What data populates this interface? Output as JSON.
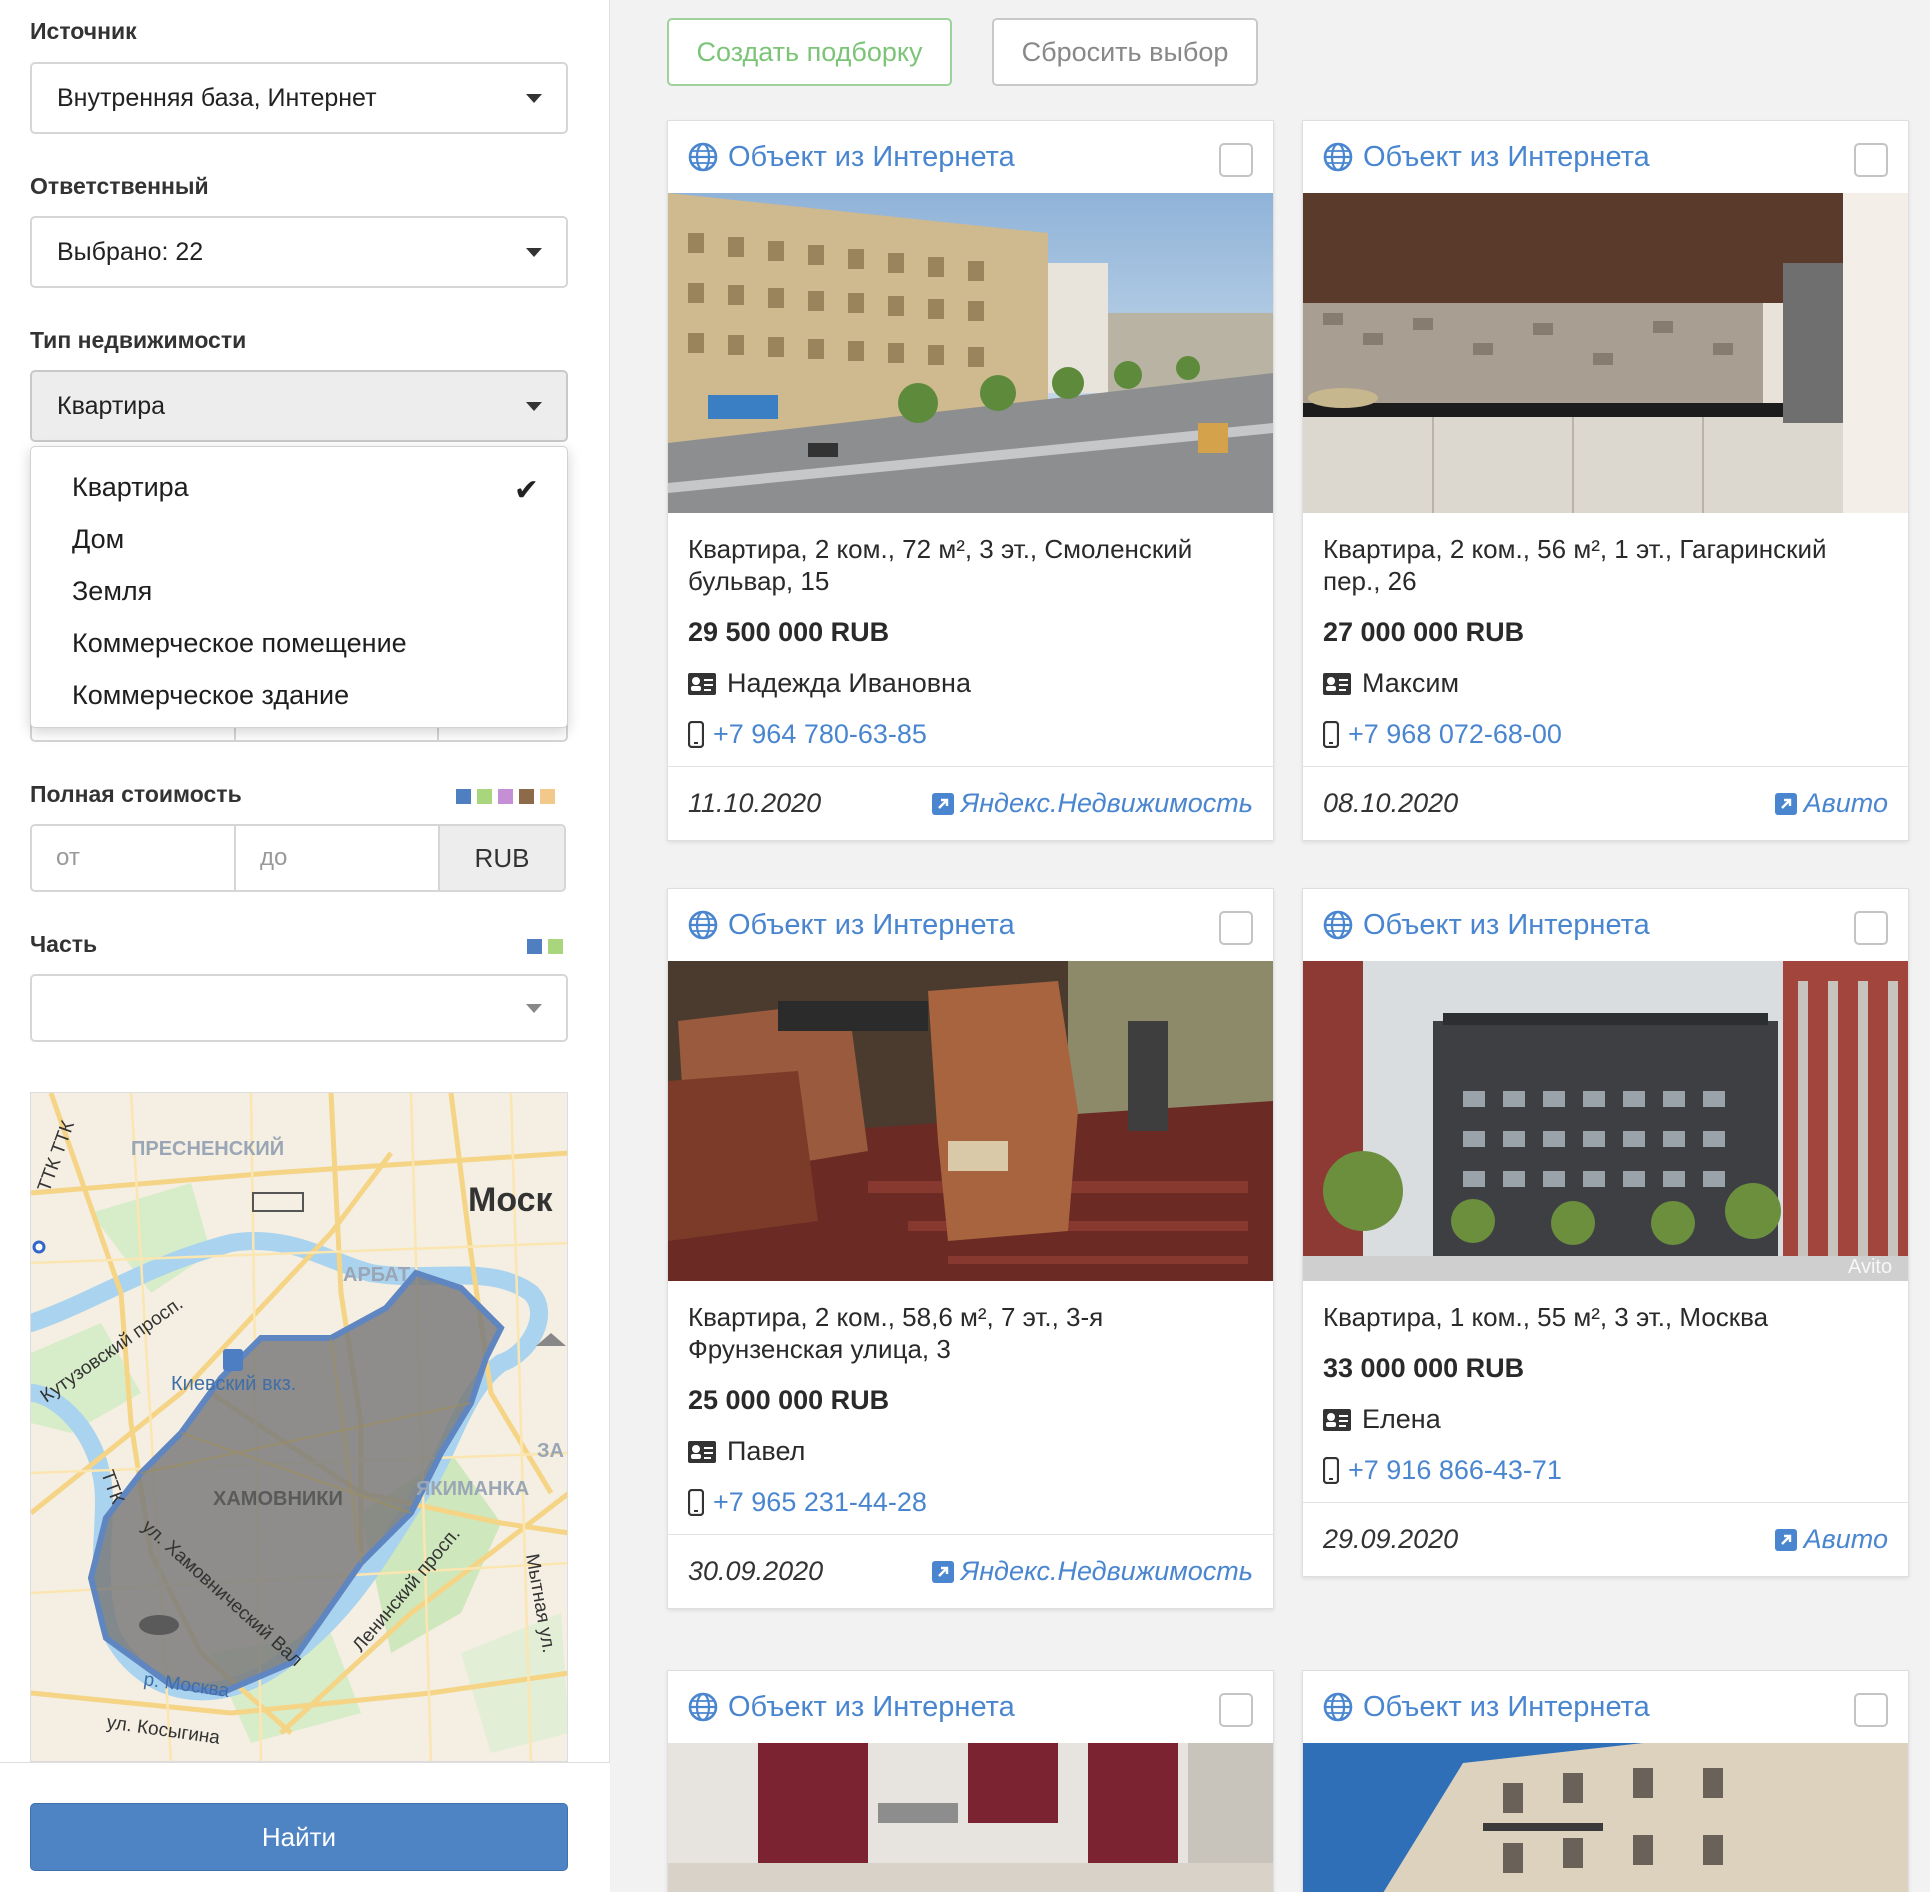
{
  "sidebar": {
    "source": {
      "label": "Источник",
      "value": "Внутренняя база, Интернет"
    },
    "responsible": {
      "label": "Ответственный",
      "value": "Выбрано: 22"
    },
    "property_type": {
      "label": "Тип недвижимости",
      "value": "Квартира",
      "options": [
        "Квартира",
        "Дом",
        "Земля",
        "Коммерческое помещение",
        "Коммерческое здание"
      ],
      "selected_index": 0
    },
    "price": {
      "label": "Полная стоимость",
      "from_placeholder": "от",
      "to_placeholder": "до",
      "currency": "RUB",
      "swatch_colors": [
        "#4f7fc0",
        "#a9d67d",
        "#c58fd6",
        "#8c6a4a",
        "#f2c98a"
      ]
    },
    "part": {
      "label": "Часть",
      "value": "",
      "swatch_colors": [
        "#4f7fc0",
        "#a9d67d"
      ]
    },
    "map": {
      "labels": {
        "presnensky": "ПРЕСНЕНСКИЙ",
        "moscow": "Моск",
        "arbat": "АРБАТ",
        "kutuzovsky": "Кутузовский просп.",
        "kievsky": "Киевский вкз.",
        "ttk1": "ТТК ТТК",
        "ttk2": "ТТК",
        "za": "ЗА",
        "yakimanka": "ЯКИМАНКА",
        "khamovniki": "ХАМОВНИКИ",
        "khamovnichesky_val": "ул. Хамовнический Вал",
        "leninsky": "Ленинский просп.",
        "mytnaya": "Мытная ул.",
        "moskva_river": "р. Москва",
        "kosygina": "ул. Косыгина"
      }
    },
    "find_label": "Найти"
  },
  "toolbar": {
    "create_label": "Создать подборку",
    "reset_label": "Сбросить выбор"
  },
  "cards": [
    {
      "source": "Объект из Интернета",
      "title": "Квартира, 2 ком., 72 м², 3 эт., Смоленский бульвар, 15",
      "price": "29 500 000 RUB",
      "contact": "Надежда Ивановна",
      "phone": "+7 964 780-63-85",
      "date": "11.10.2020",
      "link": "Яндекс.Недвижимость"
    },
    {
      "source": "Объект из Интернета",
      "title": "Квартира, 2 ком., 56 м², 1 эт., Гагаринский пер., 26",
      "price": "27 000 000 RUB",
      "contact": "Максим",
      "phone": "+7 968 072-68-00",
      "date": "08.10.2020",
      "link": "Авито"
    },
    {
      "source": "Объект из Интернета",
      "title": "Квартира, 2 ком., 58,6 м², 7 эт., 3-я Фрунзенская улица, 3",
      "price": "25 000 000 RUB",
      "contact": "Павел",
      "phone": "+7 965 231-44-28",
      "date": "30.09.2020",
      "link": "Яндекс.Недвижимость"
    },
    {
      "source": "Объект из Интернета",
      "title": "Квартира, 1 ком., 55 м², 3 эт., Москва",
      "price": "33 000 000 RUB",
      "contact": "Елена",
      "phone": "+7 916 866-43-71",
      "date": "29.09.2020",
      "link": "Авито",
      "watermark": "Avito"
    },
    {
      "source": "Объект из Интернета"
    },
    {
      "source": "Объект из Интернета"
    }
  ]
}
